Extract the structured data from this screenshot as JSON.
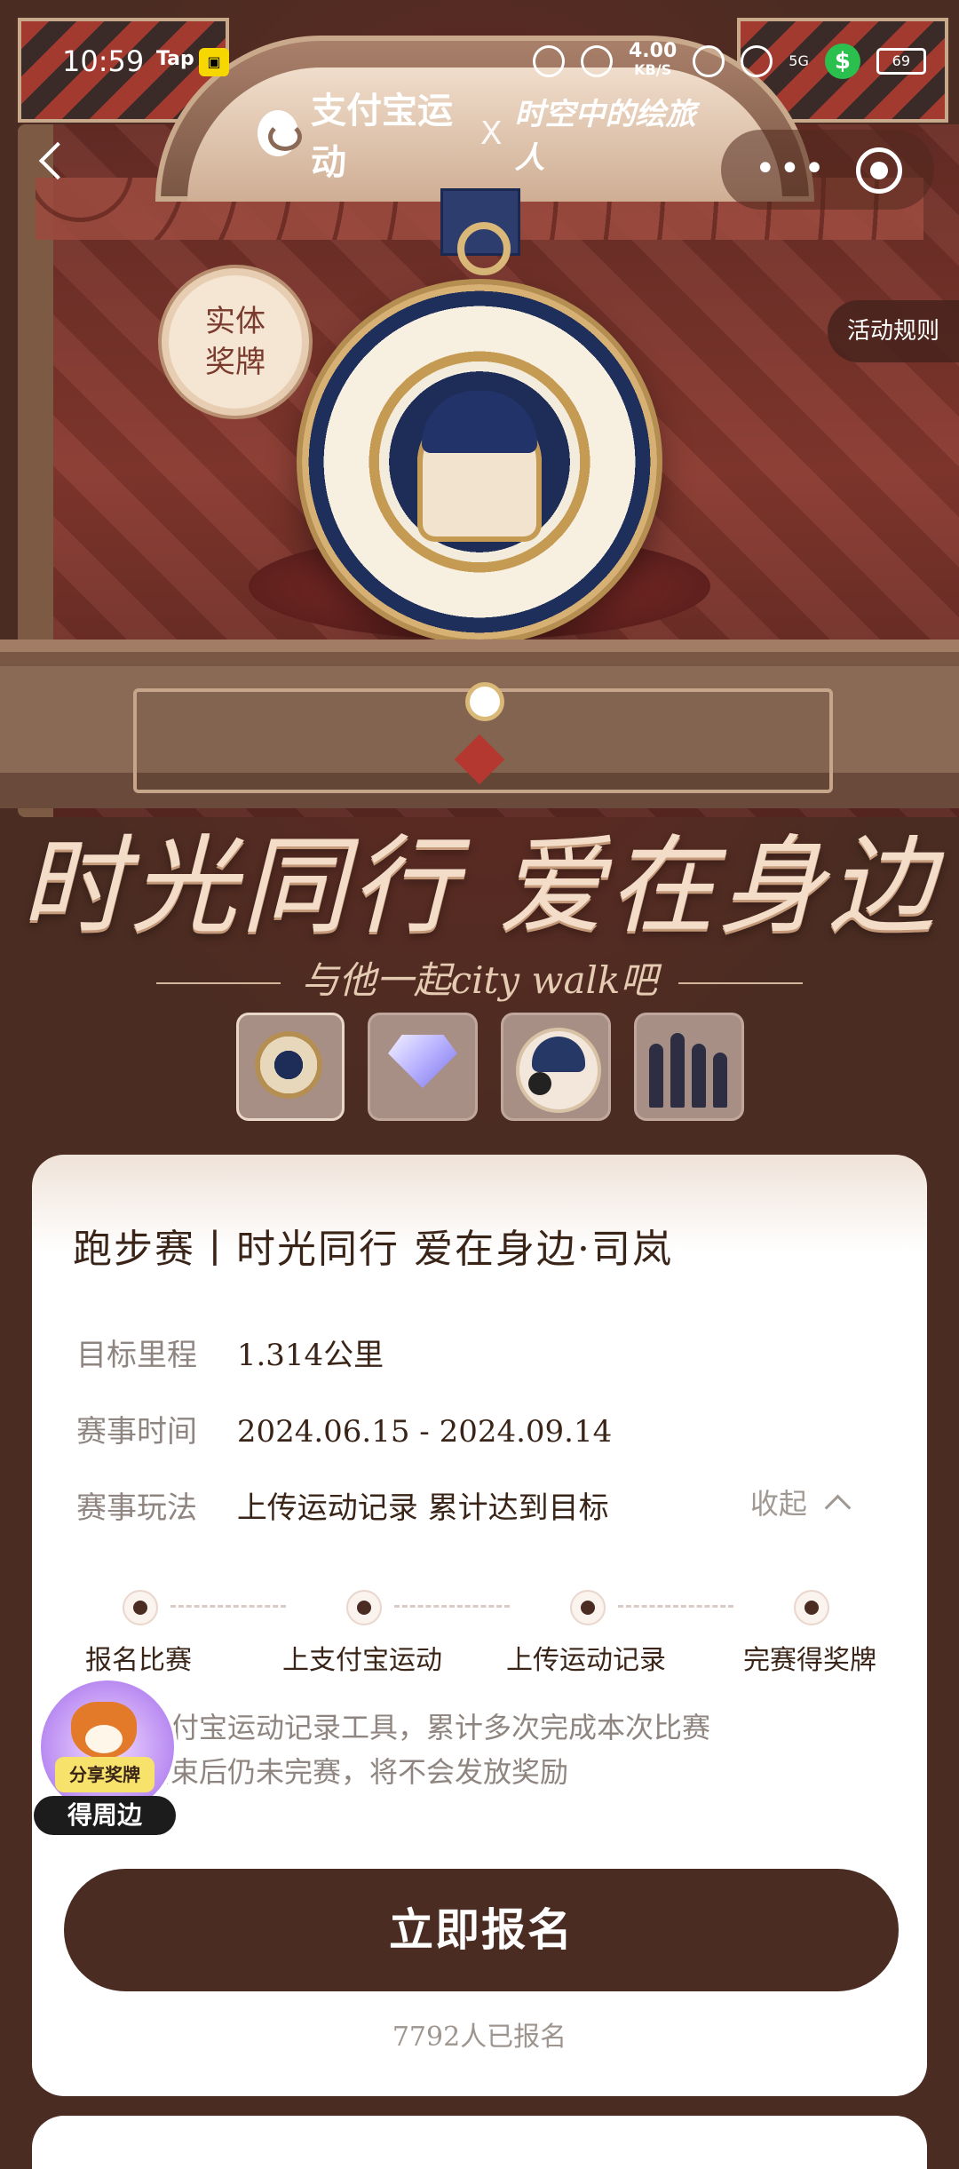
{
  "status_bar": {
    "time": "10:59",
    "tap_label": "Tap",
    "network_speed": "4.00",
    "speed_unit": "KB/S",
    "signal": "5G",
    "battery": "69"
  },
  "header": {
    "brand": "支付宝运动",
    "separator": "X",
    "partner": "时空中的绘旅人"
  },
  "hero": {
    "medal_badge": "实体\n奖牌",
    "headline": "时光同行 爱在身边",
    "subline": "与他一起city walk吧",
    "rules_label": "活动规则"
  },
  "thumbnails": [
    {
      "name": "medal"
    },
    {
      "name": "diamond"
    },
    {
      "name": "avatar"
    },
    {
      "name": "figures"
    }
  ],
  "race": {
    "title": "跑步赛丨时光同行 爱在身边·司岚",
    "target_label": "目标里程",
    "target_value": "1.314公里",
    "time_label": "赛事时间",
    "time_value": "2024.06.15 - 2024.09.14",
    "play_label": "赛事玩法",
    "play_value": "上传运动记录 累计达到目标",
    "collapse_label": "收起",
    "steps": [
      {
        "label": "报名比赛"
      },
      {
        "label": "上支付宝运动"
      },
      {
        "label": "上传运动记录"
      },
      {
        "label": "完赛得奖牌"
      }
    ],
    "desc_line1": "使用支付宝运动记录工具，累计多次完成本次比赛",
    "desc_line2": "赛事结束后仍未完赛，将不会发放奖励",
    "cta_label": "立即报名",
    "signup_count": "7792人已报名"
  },
  "share_widget": {
    "tag": "分享奖牌",
    "pill": "得周边"
  },
  "colors": {
    "accent": "#4a2c22",
    "card": "#ffffff",
    "medal_blue": "#1e2d57",
    "gold": "#d9b878"
  }
}
